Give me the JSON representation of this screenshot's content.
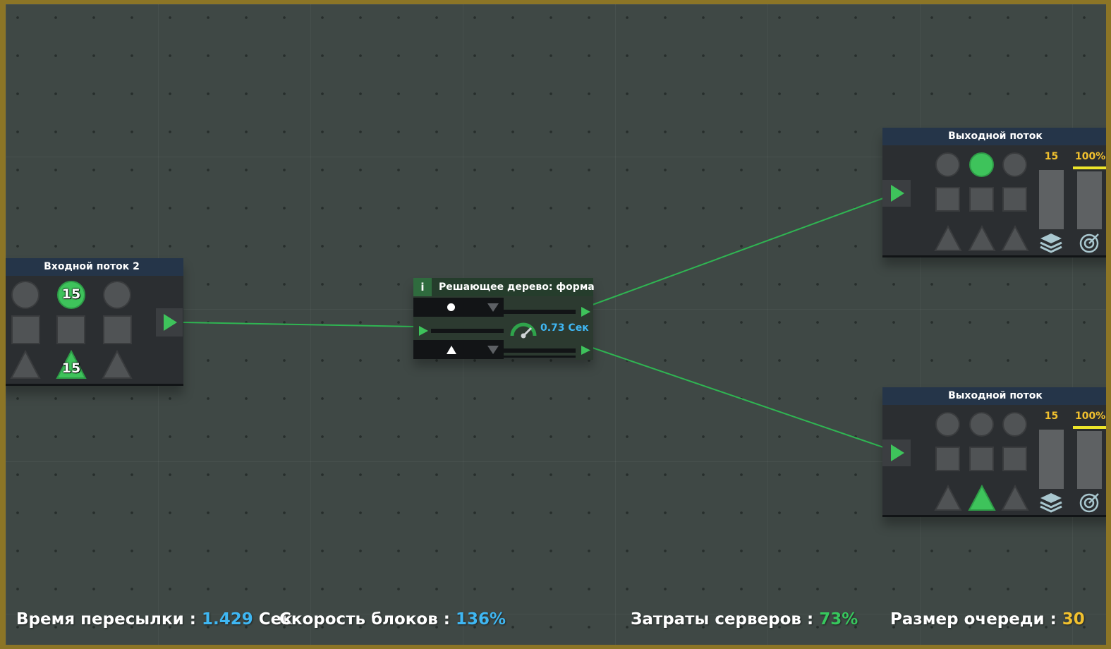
{
  "input_node": {
    "title": "Входной поток 2",
    "circle_count": "15",
    "triangle_count": "15"
  },
  "decision_node": {
    "info_label": "i",
    "title": "Решающее дерево: форма",
    "branch_top_shape": "circle",
    "branch_bottom_shape": "triangle",
    "processing_time": "0.73 Сек"
  },
  "output_nodes": [
    {
      "title": "Выходной поток",
      "queue_count": "15",
      "percent": "100%",
      "active_shape": "circle"
    },
    {
      "title": "Выходной поток",
      "queue_count": "15",
      "percent": "100%",
      "active_shape": "triangle"
    }
  ],
  "status_bar": {
    "transfer_label": "Время пересылки :",
    "transfer_value": "1.429",
    "transfer_unit": "Сек",
    "speed_label": "Скорость блоков :",
    "speed_value": "136%",
    "servers_label": "Затраты серверов :",
    "servers_value": "73%",
    "queue_label": "Размер очереди :",
    "queue_value": "30"
  },
  "colors": {
    "frame": "#8c7526",
    "board": "#3f4845",
    "header": "#253549",
    "active_green": "#3ec35b",
    "wire_green": "#2fb552",
    "value_blue": "#3fb7f3",
    "value_green": "#37c75d",
    "value_yellow": "#f2c12e"
  },
  "icons": {
    "port": "play-arrow-icon",
    "dropdown": "chevron-down-icon",
    "speed": "speedometer-icon",
    "layers": "layers-icon",
    "target": "target-icon"
  }
}
